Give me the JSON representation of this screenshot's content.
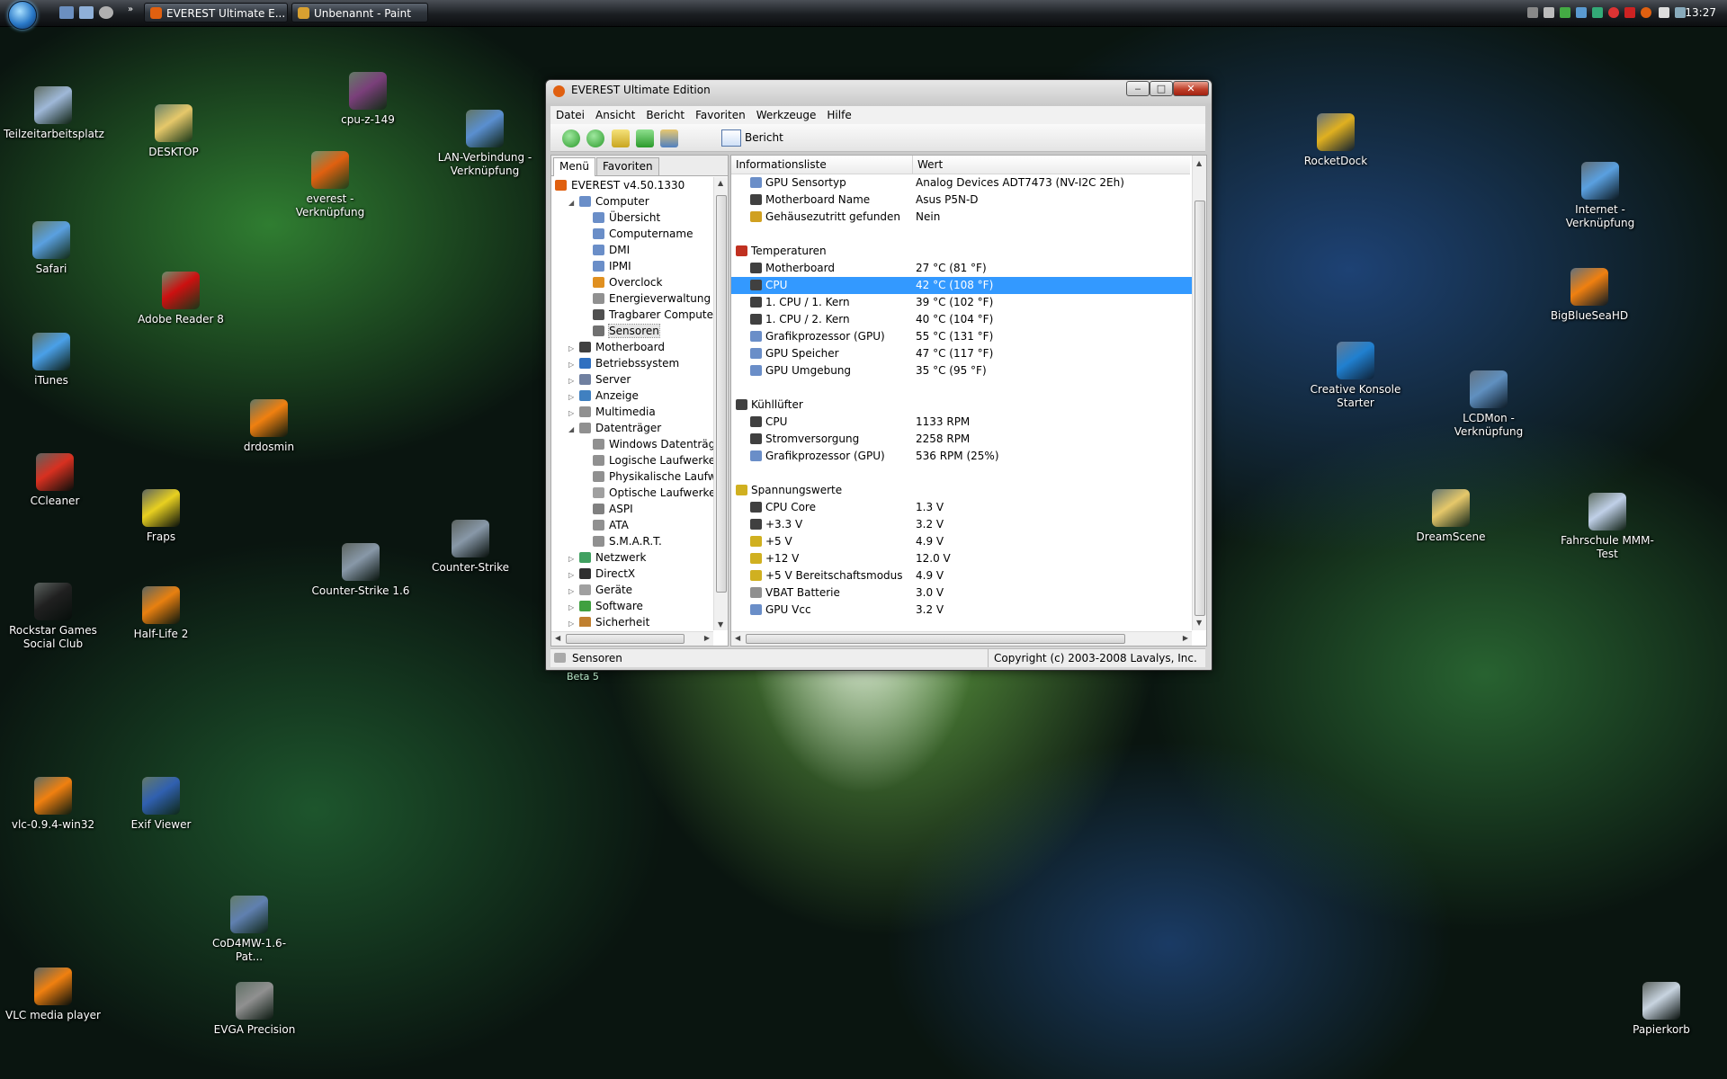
{
  "taskbar": {
    "tasks": [
      {
        "label": "EVEREST Ultimate E...",
        "color": "#e06010"
      },
      {
        "label": "Unbenannt - Paint",
        "color": "#d8a030"
      }
    ],
    "clock": "13:27"
  },
  "desktop_icons": [
    {
      "label": "Teilzeitarbeitsplatz",
      "icon": "computer-icon",
      "color": "#9fb8d8"
    },
    {
      "label": "DESKTOP",
      "icon": "folder-icon",
      "color": "#e6c86a"
    },
    {
      "label": "cpu-z-149",
      "icon": "winrar-archive-icon",
      "color": "#7a3f7a"
    },
    {
      "label": "LAN-Verbindung - Verknüpfung",
      "icon": "network-icon",
      "color": "#5a8fd0"
    },
    {
      "label": "everest - Verknüpfung",
      "icon": "everest-icon",
      "color": "#e06010"
    },
    {
      "label": "Safari",
      "icon": "safari-icon",
      "color": "#5aa0e0"
    },
    {
      "label": "Adobe Reader 8",
      "icon": "adobe-reader-icon",
      "color": "#cc1010"
    },
    {
      "label": "iTunes",
      "icon": "itunes-icon",
      "color": "#4aa0e8"
    },
    {
      "label": "drdosmin",
      "icon": "vlc-icon",
      "color": "#f08010"
    },
    {
      "label": "CCleaner",
      "icon": "ccleaner-icon",
      "color": "#d83020"
    },
    {
      "label": "Fraps",
      "icon": "fraps-icon",
      "color": "#e8d020"
    },
    {
      "label": "Counter-Strike 1.6",
      "icon": "counter-strike-icon",
      "color": "#8898a8"
    },
    {
      "label": "Counter-Strike",
      "icon": "counter-strike-icon",
      "color": "#8898a8"
    },
    {
      "label": "Rockstar Games Social Club",
      "icon": "rockstar-icon",
      "color": "#202020"
    },
    {
      "label": "Half-Life 2",
      "icon": "half-life-icon",
      "color": "#e88010"
    },
    {
      "label": "vlc-0.9.4-win32",
      "icon": "vlc-icon",
      "color": "#f08010"
    },
    {
      "label": "Exif Viewer",
      "icon": "exif-viewer-icon",
      "color": "#3060b0"
    },
    {
      "label": "CoD4MW-1.6-Pat...",
      "icon": "cod4-patch-icon",
      "color": "#6080b0"
    },
    {
      "label": "VLC media player",
      "icon": "vlc-icon",
      "color": "#f08010"
    },
    {
      "label": "EVGA Precision",
      "icon": "evga-precision-icon",
      "color": "#909090"
    },
    {
      "label": "RocketDock",
      "icon": "rocketdock-icon",
      "color": "#e0b020"
    },
    {
      "label": "Internet - Verknüpfung",
      "icon": "internet-icon",
      "color": "#5aa0e0"
    },
    {
      "label": "BigBlueSeaHD",
      "icon": "vlc-icon",
      "color": "#f08010"
    },
    {
      "label": "Creative Konsole Starter",
      "icon": "creative-icon",
      "color": "#2080d0"
    },
    {
      "label": "LCDMon - Verknüpfung",
      "icon": "lcdmon-icon",
      "color": "#6090c0"
    },
    {
      "label": "DreamScene",
      "icon": "folder-icon",
      "color": "#e6c86a"
    },
    {
      "label": "Fahrschule MMM-Test",
      "icon": "cd-icon",
      "color": "#c0d0e8"
    },
    {
      "label": "Papierkorb",
      "icon": "recycle-bin-icon",
      "color": "#c8d4e0"
    }
  ],
  "beta_label": "Beta 5",
  "window": {
    "title": "EVEREST Ultimate Edition",
    "menu": [
      "Datei",
      "Ansicht",
      "Bericht",
      "Favoriten",
      "Werkzeuge",
      "Hilfe"
    ],
    "report_label": "Bericht",
    "tabs": [
      "Menü",
      "Favoriten"
    ],
    "tree": [
      {
        "label": "EVEREST v4.50.1330",
        "level": 0,
        "exp": "",
        "color": "#e06010",
        "icon": "everest-icon"
      },
      {
        "label": "Computer",
        "level": 1,
        "exp": "◢",
        "color": "#6a8ec8",
        "icon": "computer-icon"
      },
      {
        "label": "Übersicht",
        "level": 2,
        "exp": "",
        "color": "#6a8ec8",
        "icon": "info-icon"
      },
      {
        "label": "Computername",
        "level": 2,
        "exp": "",
        "color": "#6a8ec8",
        "icon": "info-icon"
      },
      {
        "label": "DMI",
        "level": 2,
        "exp": "",
        "color": "#6a8ec8",
        "icon": "info-icon"
      },
      {
        "label": "IPMI",
        "level": 2,
        "exp": "",
        "color": "#6a8ec8",
        "icon": "info-icon"
      },
      {
        "label": "Overclock",
        "level": 2,
        "exp": "",
        "color": "#e09020",
        "icon": "flame-icon"
      },
      {
        "label": "Energieverwaltung",
        "level": 2,
        "exp": "",
        "color": "#909090",
        "icon": "power-icon"
      },
      {
        "label": "Tragbarer Computer",
        "level": 2,
        "exp": "",
        "color": "#505050",
        "icon": "laptop-icon"
      },
      {
        "label": "Sensoren",
        "level": 2,
        "exp": "",
        "color": "#707070",
        "icon": "sensor-icon",
        "selected": true
      },
      {
        "label": "Motherboard",
        "level": 1,
        "exp": "▷",
        "color": "#404040",
        "icon": "motherboard-icon"
      },
      {
        "label": "Betriebssystem",
        "level": 1,
        "exp": "▷",
        "color": "#3070c0",
        "icon": "windows-icon"
      },
      {
        "label": "Server",
        "level": 1,
        "exp": "▷",
        "color": "#7080a0",
        "icon": "server-icon"
      },
      {
        "label": "Anzeige",
        "level": 1,
        "exp": "▷",
        "color": "#4080c0",
        "icon": "display-icon"
      },
      {
        "label": "Multimedia",
        "level": 1,
        "exp": "▷",
        "color": "#909090",
        "icon": "multimedia-icon"
      },
      {
        "label": "Datenträger",
        "level": 1,
        "exp": "◢",
        "color": "#909090",
        "icon": "storage-icon"
      },
      {
        "label": "Windows Datenträger",
        "level": 2,
        "exp": "",
        "color": "#909090",
        "icon": "disk-icon"
      },
      {
        "label": "Logische Laufwerke",
        "level": 2,
        "exp": "",
        "color": "#909090",
        "icon": "disk-icon"
      },
      {
        "label": "Physikalische Laufwerke",
        "level": 2,
        "exp": "",
        "color": "#909090",
        "icon": "disk-icon"
      },
      {
        "label": "Optische Laufwerke",
        "level": 2,
        "exp": "",
        "color": "#a0a0a0",
        "icon": "optical-drive-icon"
      },
      {
        "label": "ASPI",
        "level": 2,
        "exp": "",
        "color": "#808080",
        "icon": "aspi-icon"
      },
      {
        "label": "ATA",
        "level": 2,
        "exp": "",
        "color": "#909090",
        "icon": "ata-icon"
      },
      {
        "label": "S.M.A.R.T.",
        "level": 2,
        "exp": "",
        "color": "#909090",
        "icon": "smart-icon"
      },
      {
        "label": "Netzwerk",
        "level": 1,
        "exp": "▷",
        "color": "#40a060",
        "icon": "network-icon"
      },
      {
        "label": "DirectX",
        "level": 1,
        "exp": "▷",
        "color": "#303030",
        "icon": "directx-icon"
      },
      {
        "label": "Geräte",
        "level": 1,
        "exp": "▷",
        "color": "#a0a0a0",
        "icon": "devices-icon"
      },
      {
        "label": "Software",
        "level": 1,
        "exp": "▷",
        "color": "#40a040",
        "icon": "software-icon"
      },
      {
        "label": "Sicherheit",
        "level": 1,
        "exp": "▷",
        "color": "#c08030",
        "icon": "security-icon"
      }
    ],
    "columns": {
      "info": "Informationsliste",
      "value": "Wert"
    },
    "rows": [
      {
        "label": "GPU Sensortyp",
        "value": "Analog Devices ADT7473  (NV-I2C 2Eh)",
        "kind": "item",
        "color": "#6a8ec8",
        "icon": "gpu-icon"
      },
      {
        "label": "Motherboard Name",
        "value": "Asus P5N-D",
        "kind": "item",
        "color": "#404040",
        "icon": "motherboard-icon"
      },
      {
        "label": "Gehäusezutritt gefunden",
        "value": "Nein",
        "kind": "item",
        "color": "#d0a020",
        "icon": "lock-icon"
      },
      {
        "label": "",
        "value": "",
        "kind": "blank"
      },
      {
        "label": "Temperaturen",
        "value": "",
        "kind": "group",
        "color": "#c03020",
        "icon": "thermometer-icon"
      },
      {
        "label": "Motherboard",
        "value": "27 °C  (81 °F)",
        "kind": "item",
        "color": "#404040",
        "icon": "motherboard-icon"
      },
      {
        "label": "CPU",
        "value": "42 °C  (108 °F)",
        "kind": "item",
        "color": "#404040",
        "icon": "cpu-icon",
        "selected": true
      },
      {
        "label": "1. CPU / 1. Kern",
        "value": "39 °C  (102 °F)",
        "kind": "item",
        "color": "#404040",
        "icon": "cpu-icon"
      },
      {
        "label": "1. CPU / 2. Kern",
        "value": "40 °C  (104 °F)",
        "kind": "item",
        "color": "#404040",
        "icon": "cpu-icon"
      },
      {
        "label": "Grafikprozessor (GPU)",
        "value": "55 °C  (131 °F)",
        "kind": "item",
        "color": "#6a8ec8",
        "icon": "gpu-icon"
      },
      {
        "label": "GPU Speicher",
        "value": "47 °C  (117 °F)",
        "kind": "item",
        "color": "#6a8ec8",
        "icon": "gpu-icon"
      },
      {
        "label": "GPU Umgebung",
        "value": "35 °C  (95 °F)",
        "kind": "item",
        "color": "#6a8ec8",
        "icon": "gpu-icon"
      },
      {
        "label": "",
        "value": "",
        "kind": "blank"
      },
      {
        "label": "Kühllüfter",
        "value": "",
        "kind": "group",
        "color": "#404040",
        "icon": "fan-icon"
      },
      {
        "label": "CPU",
        "value": "1133 RPM",
        "kind": "item",
        "color": "#404040",
        "icon": "cpu-icon"
      },
      {
        "label": "Stromversorgung",
        "value": "2258 RPM",
        "kind": "item",
        "color": "#404040",
        "icon": "power-supply-icon"
      },
      {
        "label": "Grafikprozessor (GPU)",
        "value": "536 RPM  (25%)",
        "kind": "item",
        "color": "#6a8ec8",
        "icon": "gpu-icon"
      },
      {
        "label": "",
        "value": "",
        "kind": "blank"
      },
      {
        "label": "Spannungswerte",
        "value": "",
        "kind": "group",
        "color": "#d0b020",
        "icon": "voltage-icon"
      },
      {
        "label": "CPU Core",
        "value": "1.3 V",
        "kind": "item",
        "color": "#404040",
        "icon": "cpu-icon"
      },
      {
        "label": "+3.3 V",
        "value": "3.2 V",
        "kind": "item",
        "color": "#404040",
        "icon": "cpu-icon"
      },
      {
        "label": "+5 V",
        "value": "4.9 V",
        "kind": "item",
        "color": "#d0b020",
        "icon": "voltage-icon"
      },
      {
        "label": "+12 V",
        "value": "12.0 V",
        "kind": "item",
        "color": "#d0b020",
        "icon": "voltage-icon"
      },
      {
        "label": "+5 V Bereitschaftsmodus",
        "value": "4.9 V",
        "kind": "item",
        "color": "#d0b020",
        "icon": "voltage-icon"
      },
      {
        "label": "VBAT Batterie",
        "value": "3.0 V",
        "kind": "item",
        "color": "#909090",
        "icon": "battery-icon"
      },
      {
        "label": "GPU Vcc",
        "value": "3.2 V",
        "kind": "item",
        "color": "#6a8ec8",
        "icon": "gpu-icon"
      }
    ],
    "status_left": "Sensoren",
    "status_right": "Copyright (c) 2003-2008 Lavalys, Inc."
  }
}
